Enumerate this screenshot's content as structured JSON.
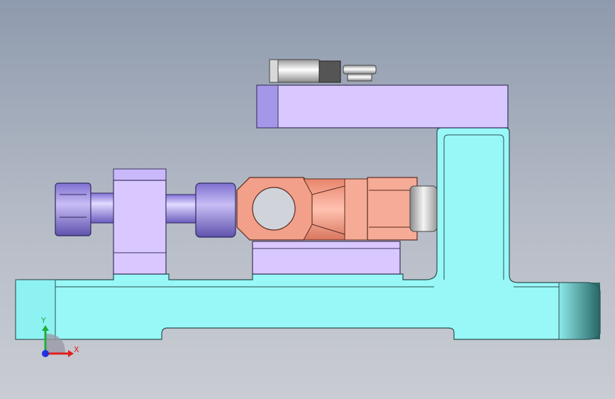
{
  "viewport": {
    "background_top": "#8e9aad",
    "background_bottom": "#c9ccd2"
  },
  "colors": {
    "base_plate": "#98f8f8",
    "base_edge": "#2f5a5a",
    "fixture_block": "#d8c6ff",
    "fixture_block_shade": "#a596e6",
    "hex_nut": "#a99ae8",
    "copper_part": "#f4a48e",
    "steel": "#c9c9c9"
  },
  "triad": {
    "x_label": "X",
    "y_label": "Y",
    "x_color": "#e01f1f",
    "y_color": "#1fae3a",
    "z_color": "#2430e0"
  }
}
